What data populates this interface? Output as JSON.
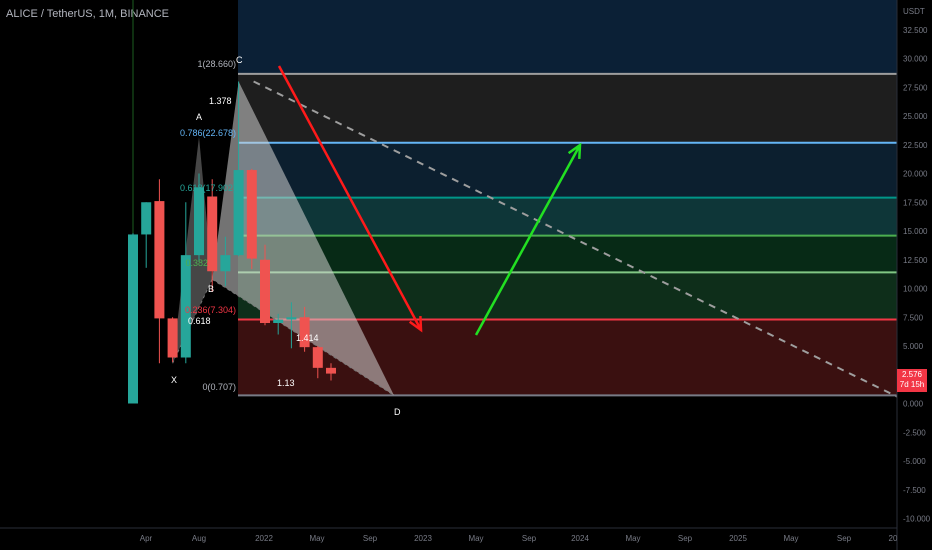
{
  "title": "ALICE / TetherUS, 1M, BINANCE",
  "currency": "USDT",
  "last_price": "2.576",
  "countdown": "7d 15h",
  "chart_data": {
    "type": "candlestick",
    "y_axis_ticks": [
      "32.500",
      "30.000",
      "27.500",
      "25.000",
      "22.500",
      "20.000",
      "17.500",
      "15.000",
      "12.500",
      "10.000",
      "7.500",
      "5.000",
      "2.500",
      "0.000",
      "-2.500",
      "-5.000",
      "-7.500",
      "-10.000"
    ],
    "y_tick_values": [
      32.5,
      30,
      27.5,
      25,
      22.5,
      20,
      17.5,
      15,
      12.5,
      10,
      7.5,
      5,
      2.5,
      0,
      -2.5,
      -5,
      -7.5,
      -10
    ],
    "x_axis_ticks": [
      "Apr",
      "Aug",
      "2022",
      "May",
      "Sep",
      "2023",
      "May",
      "Sep",
      "2024",
      "May",
      "Sep",
      "2025",
      "May",
      "Sep",
      "20"
    ],
    "candles": [
      {
        "o": 0.0,
        "h": 14.8,
        "l": 0.0,
        "c": 14.7
      },
      {
        "o": 14.7,
        "h": 17.5,
        "l": 11.8,
        "c": 17.5
      },
      {
        "o": 17.6,
        "h": 19.5,
        "l": 3.5,
        "c": 7.4
      },
      {
        "o": 7.4,
        "h": 7.5,
        "l": 3.6,
        "c": 4.0
      },
      {
        "o": 4.0,
        "h": 17.5,
        "l": 3.5,
        "c": 12.9
      },
      {
        "o": 12.9,
        "h": 20.0,
        "l": 12.3,
        "c": 18.8
      },
      {
        "o": 18.0,
        "h": 19.5,
        "l": 9.7,
        "c": 11.5
      },
      {
        "o": 11.5,
        "h": 14.5,
        "l": 10.2,
        "c": 12.9
      },
      {
        "o": 12.9,
        "h": 28.0,
        "l": 12.8,
        "c": 20.3
      },
      {
        "o": 20.3,
        "h": 20.4,
        "l": 11.7,
        "c": 12.6
      },
      {
        "o": 12.5,
        "h": 13.8,
        "l": 6.8,
        "c": 7.0
      },
      {
        "o": 7.0,
        "h": 7.8,
        "l": 6.0,
        "c": 7.3
      },
      {
        "o": 7.3,
        "h": 8.8,
        "l": 4.8,
        "c": 7.5
      },
      {
        "o": 7.5,
        "h": 8.4,
        "l": 4.5,
        "c": 4.9
      },
      {
        "o": 4.9,
        "h": 5.0,
        "l": 2.2,
        "c": 3.1
      },
      {
        "o": 3.1,
        "h": 3.5,
        "l": 2.0,
        "c": 2.6
      }
    ],
    "fib_levels": [
      {
        "value": 28.66,
        "color": "#9e9e9e",
        "fill": "#1e1e1e"
      },
      {
        "value": 22.678,
        "color": "#64b5f6",
        "fill": "#0c1f2f"
      },
      {
        "value": 17.902,
        "color": "#009688",
        "fill": "#0e3638"
      },
      {
        "value": 14.6,
        "color": "#4caf50",
        "fill": "#072a16"
      },
      {
        "value": 11.4,
        "color": "#81c784",
        "fill": "#0e2e1a"
      },
      {
        "value": 7.304,
        "color": "#f23645",
        "fill": "#1a2418"
      },
      {
        "value": 0.707,
        "color": "#787b86",
        "fill": "#3a1010"
      }
    ],
    "labels": {
      "fib_top": "1(28.660)",
      "fib_786": "0.786(22.678)",
      "fib_618": "0.618(17.902)",
      "fib_382": "0.382",
      "fib_236": "0.236(7.304)",
      "fib_zero": "0(0.707)",
      "ratio_1378": "1.378",
      "ratio_618": "0.618",
      "ratio_113": "1.13",
      "ratio_1414": "1.414",
      "pt_X": "X",
      "pt_A": "A",
      "pt_B": "B",
      "pt_C": "C",
      "pt_D": "D"
    },
    "pattern_points": {
      "X": {
        "candle": 3,
        "value": 3.5
      },
      "A": {
        "candle": 5,
        "value": 23.2
      },
      "B": {
        "candle": 6,
        "value": 10.8
      },
      "C": {
        "candle": 8,
        "value": 28.0
      },
      "D": {
        "candle": "future",
        "value": 0.707
      }
    },
    "colors": {
      "up": "#26a69a",
      "down": "#ef5350",
      "bg": "#000000",
      "axis_text": "#787b86"
    }
  }
}
